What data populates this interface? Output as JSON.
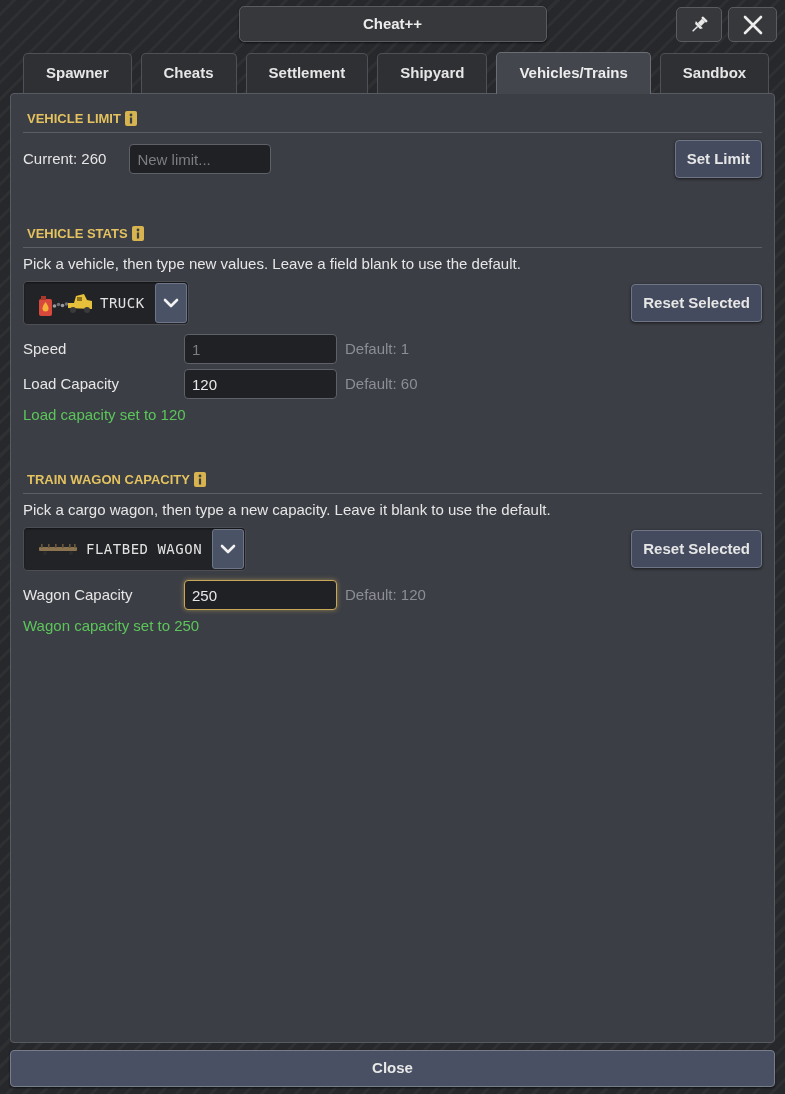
{
  "window": {
    "title": "Cheat++"
  },
  "tabs": [
    {
      "label": "Spawner",
      "selected": false
    },
    {
      "label": "Cheats",
      "selected": false
    },
    {
      "label": "Settlement",
      "selected": false
    },
    {
      "label": "Shipyard",
      "selected": false
    },
    {
      "label": "Vehicles/Trains",
      "selected": true
    },
    {
      "label": "Sandbox",
      "selected": false
    }
  ],
  "sections": [
    {
      "kind": "limit",
      "title": "VEHICLE LIMIT",
      "current": "Current: 260",
      "input": {
        "placeholder": "New limit..."
      },
      "button": "Set Limit"
    },
    {
      "kind": "vehicle",
      "title": "VEHICLE STATS",
      "description": "Pick a vehicle, then type new values. Leave a field blank to use the default.",
      "dropdown": {
        "value": "TRUCK"
      },
      "button": "Reset Selected",
      "fields": [
        {
          "label": "Speed",
          "placeholder": "1",
          "focused": false,
          "default": "Default: 1"
        },
        {
          "label": "Load Capacity",
          "value": "120",
          "focused": false,
          "default": "Default: 60"
        }
      ],
      "message": "Load capacity set to 120"
    },
    {
      "kind": "wagon",
      "title": "TRAIN WAGON CAPACITY",
      "description": "Pick a cargo wagon, then type a new capacity. Leave it blank to use the default.",
      "dropdown": {
        "value": "FLATBED WAGON"
      },
      "button": "Reset Selected",
      "fields": [
        {
          "label": "Wagon Capacity",
          "value": "250",
          "focused": true,
          "default": "Default: 120"
        }
      ],
      "message": "Wagon capacity set to 250"
    }
  ],
  "close_button": "Close"
}
